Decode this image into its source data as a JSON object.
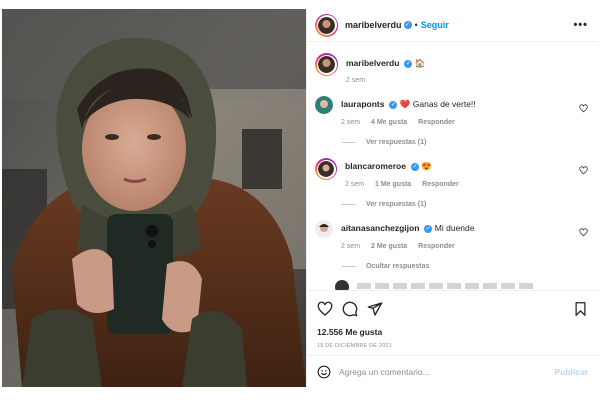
{
  "header": {
    "username": "maribelverdu",
    "follow_label": "Seguir",
    "more_label": "•••"
  },
  "caption": {
    "username": "maribelverdu",
    "emoji": "🏠",
    "time": "2 sem"
  },
  "comments": [
    {
      "username": "lauraponts",
      "emoji": "❤️",
      "text": "Ganas de verte!!",
      "time": "2 sem",
      "likes": "4 Me gusta",
      "reply_label": "Responder",
      "replies_label": "Ver respuestas (1)"
    },
    {
      "username": "blancaromeroe",
      "emoji": "😍",
      "text": "",
      "time": "2 sem",
      "likes": "1 Me gusta",
      "reply_label": "Responder",
      "replies_label": "Ver respuestas (1)"
    },
    {
      "username": "aitanasanchezgijon",
      "emoji": "",
      "text": "Mi duende",
      "time": "2 sem",
      "likes": "2 Me gusta",
      "reply_label": "Responder",
      "replies_label": "Ocultar respuestas"
    }
  ],
  "stats": {
    "likes": "12.556 Me gusta",
    "date": "19 DE DICIEMBRE DE 2021"
  },
  "add_comment": {
    "placeholder": "Agrega un comentario...",
    "publish_label": "Publicar"
  },
  "icons": {
    "verified": "verified-badge",
    "like": "heart-icon",
    "comment": "comment-icon",
    "share": "share-icon",
    "save": "bookmark-icon",
    "emoji": "emoji-icon"
  },
  "colors": {
    "accent": "#0095f6",
    "muted": "#8e8e8e",
    "publish_disabled": "#b3dbff",
    "verified": "#3897f0",
    "heart_red": "#ed4956"
  }
}
